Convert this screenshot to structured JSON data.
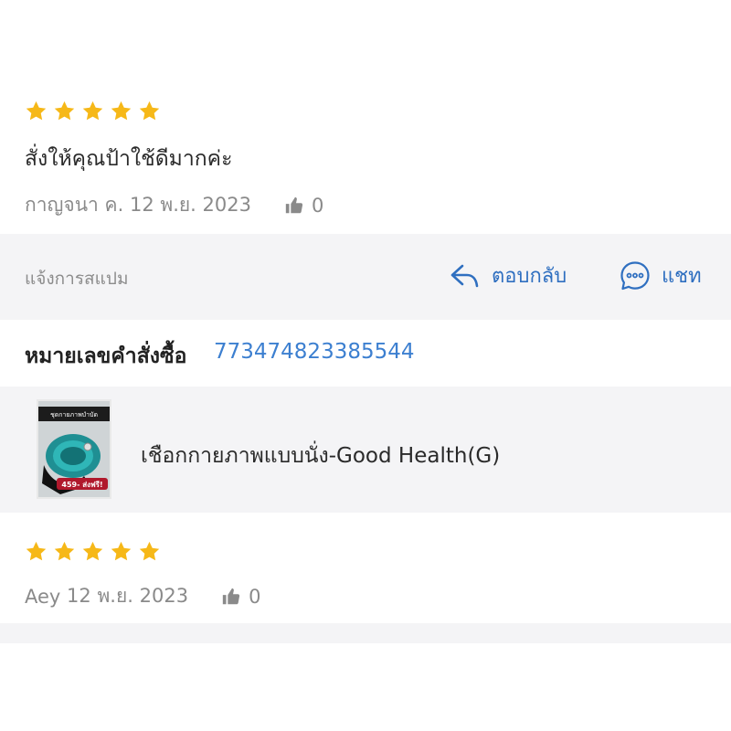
{
  "reviews": [
    {
      "rating": 5,
      "text": "สั่งให้คุณป้าใช้ดีมากค่ะ",
      "author": "กาญจนา ค.",
      "date": "12 พ.ย. 2023",
      "likes": "0"
    },
    {
      "rating": 5,
      "author": "Aey",
      "date": "12 พ.ย. 2023",
      "likes": "0"
    }
  ],
  "actions": {
    "report_label": "แจ้งการสแปม",
    "reply_label": "ตอบกลับ",
    "chat_label": "แชท"
  },
  "order": {
    "label": "หมายเลขคำสั่งซื้อ",
    "number": "773474823385544"
  },
  "product": {
    "name": "เชือกกายภาพแบบนั่ง-Good Health(G)",
    "thumb_caption": "ชุดกายภาพบำบัด",
    "thumb_price": "459- ส่งฟรี!"
  },
  "colors": {
    "star": "#f6b818",
    "accent_blue": "#2f6fc0",
    "link_blue": "#3c7fd0",
    "muted_gray": "#8a8a8a",
    "band_gray": "#f4f4f6"
  },
  "icons": {
    "star": "star-icon",
    "thumbs_up": "thumbs-up-icon",
    "reply": "reply-arrow-icon",
    "chat": "chat-bubble-icon"
  }
}
